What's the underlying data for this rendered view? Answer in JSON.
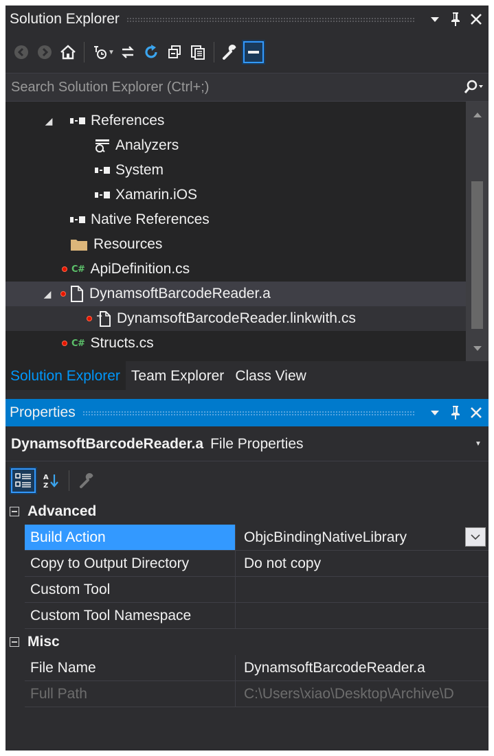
{
  "solution_explorer": {
    "title": "Solution Explorer",
    "search_placeholder": "Search Solution Explorer (Ctrl+;)",
    "tree": [
      {
        "label": "References"
      },
      {
        "label": "Analyzers"
      },
      {
        "label": "System"
      },
      {
        "label": "Xamarin.iOS"
      },
      {
        "label": "Native References"
      },
      {
        "label": "Resources"
      },
      {
        "label": "ApiDefinition.cs",
        "badge": "C#"
      },
      {
        "label": "DynamsoftBarcodeReader.a"
      },
      {
        "label": "DynamsoftBarcodeReader.linkwith.cs"
      },
      {
        "label": "Structs.cs",
        "badge": "C#"
      }
    ]
  },
  "tabs": [
    {
      "label": "Solution Explorer"
    },
    {
      "label": "Team Explorer"
    },
    {
      "label": "Class View"
    }
  ],
  "properties": {
    "title": "Properties",
    "object_name": "DynamsoftBarcodeReader.a",
    "object_type": "File Properties",
    "categories": [
      {
        "name": "Advanced",
        "rows": [
          {
            "name": "Build Action",
            "value": "ObjcBindingNativeLibrary"
          },
          {
            "name": "Copy to Output Directory",
            "value": "Do not copy"
          },
          {
            "name": "Custom Tool",
            "value": ""
          },
          {
            "name": "Custom Tool Namespace",
            "value": ""
          }
        ]
      },
      {
        "name": "Misc",
        "rows": [
          {
            "name": "File Name",
            "value": "DynamsoftBarcodeReader.a"
          },
          {
            "name": "Full Path",
            "value": "C:\\Users\\xiao\\Desktop\\Archive\\D"
          }
        ]
      }
    ]
  },
  "colors": {
    "background": "#2d2d30",
    "tree_background": "#252526",
    "accent": "#007acc",
    "selection": "#3399ff",
    "active_tab_text": "#0097fb",
    "csharp_badge": "#5cc16a",
    "error_dot": "#e51400",
    "folder": "#dcb67a"
  }
}
